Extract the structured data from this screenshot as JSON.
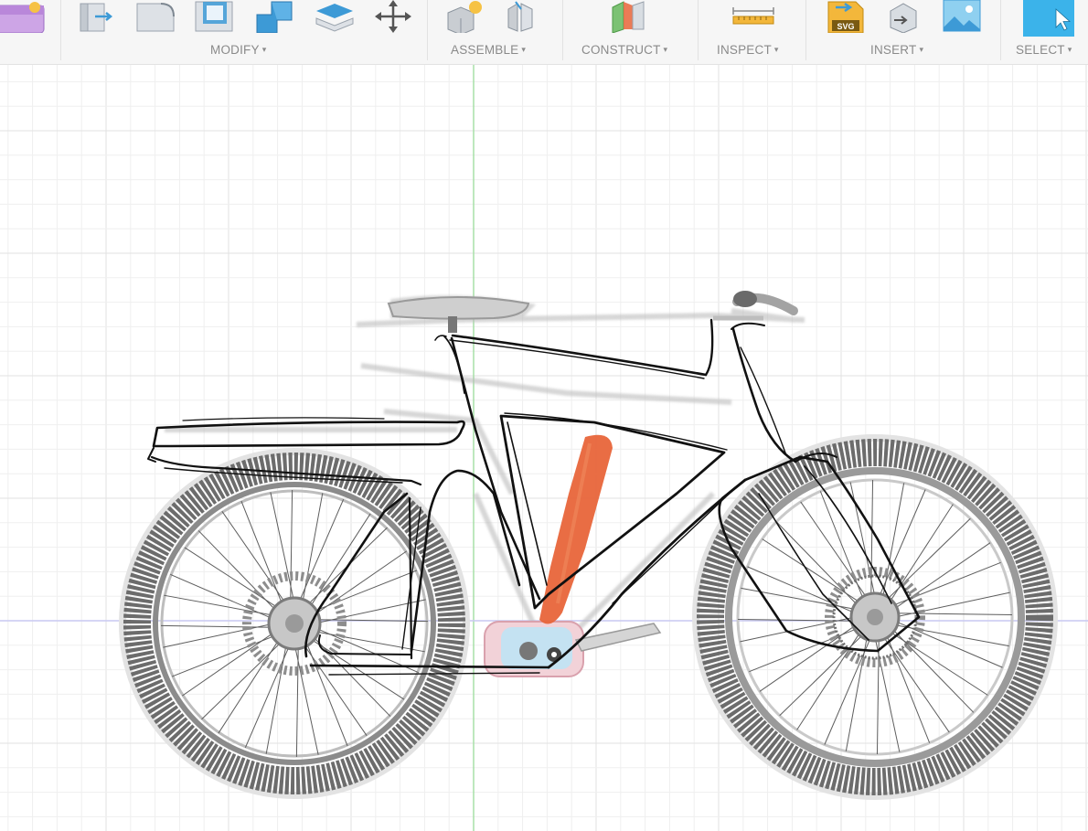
{
  "toolbar": {
    "groups": [
      {
        "id": "modify",
        "label": "MODIFY"
      },
      {
        "id": "assemble",
        "label": "ASSEMBLE"
      },
      {
        "id": "construct",
        "label": "CONSTRUCT"
      },
      {
        "id": "inspect",
        "label": "INSPECT"
      },
      {
        "id": "insert",
        "label": "INSERT"
      },
      {
        "id": "select",
        "label": "SELECT"
      }
    ],
    "caret": "▾",
    "insert_svg_badge": "SVG"
  },
  "colors": {
    "toolbar_bg": "#f6f6f6",
    "label_text": "#8a8a8a",
    "icon_blue": "#3d9ad6",
    "icon_gray": "#c9cdd2",
    "select_blue": "#3bb3ea",
    "grid_minor": "#efefef",
    "grid_major": "#e2e2e2",
    "axis_green": "#a7e0a7",
    "axis_blue": "#c9c9f2",
    "tire_gray": "#777777",
    "sketch_ink": "#111111",
    "highlight_orange": "#e8653a"
  },
  "icons": {
    "create": "purple-sparkle-box-icon",
    "modify": [
      "press-pull-icon",
      "fillet-icon",
      "shell-icon",
      "combine-icon",
      "offset-face-icon",
      "move-icon"
    ],
    "assemble": [
      "new-component-icon",
      "joint-icon"
    ],
    "construct": [
      "offset-plane-icon"
    ],
    "inspect": [
      "measure-icon"
    ],
    "insert": [
      "insert-svg-icon",
      "insert-mesh-icon",
      "canvas-image-icon"
    ],
    "select": [
      "select-arrow-icon"
    ]
  }
}
